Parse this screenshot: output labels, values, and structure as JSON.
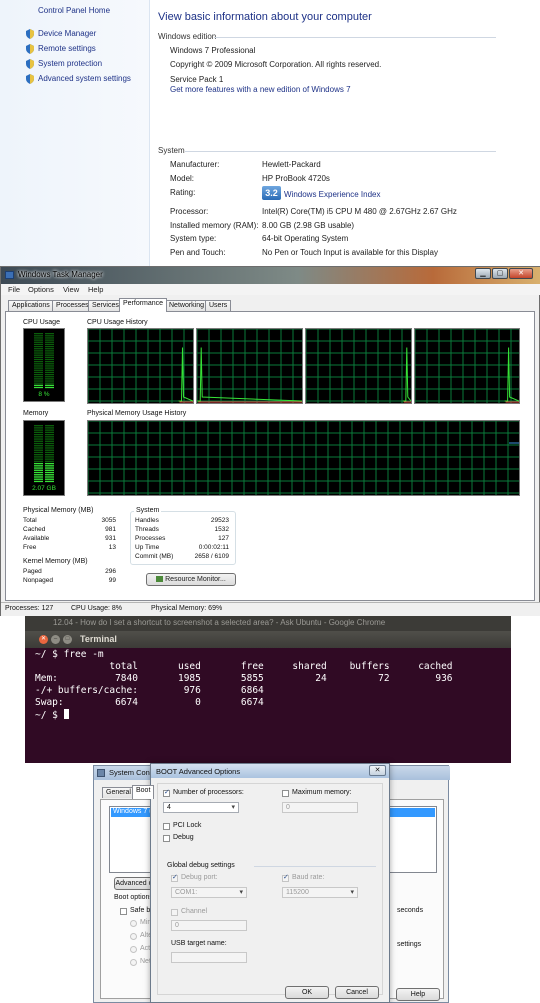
{
  "system_panel": {
    "sidebar": {
      "home": "Control Panel Home",
      "links": [
        "Device Manager",
        "Remote settings",
        "System protection",
        "Advanced system settings"
      ]
    },
    "heading": "View basic information about your computer",
    "edition_header": "Windows edition",
    "edition": "Windows 7 Professional",
    "copyright": "Copyright © 2009 Microsoft Corporation.  All rights reserved.",
    "service_pack": "Service Pack 1",
    "more_features_link": "Get more features with a new edition of Windows 7",
    "system_header": "System",
    "rows": [
      {
        "label": "Manufacturer:",
        "value": "Hewlett-Packard"
      },
      {
        "label": "Model:",
        "value": "HP ProBook 4720s"
      },
      {
        "label": "Rating:",
        "value": ""
      },
      {
        "label": "Processor:",
        "value": "Intel(R) Core(TM) i5 CPU       M 480  @ 2.67GHz   2.67 GHz"
      },
      {
        "label": "Installed memory (RAM):",
        "value": "8.00 GB (2.98 GB usable)"
      },
      {
        "label": "System type:",
        "value": "64-bit Operating System"
      },
      {
        "label": "Pen and Touch:",
        "value": "No Pen or Touch Input is available for this Display"
      }
    ],
    "rating_score": "3.2",
    "rating_link": "Windows Experience Index"
  },
  "task_manager": {
    "title": "Windows Task Manager",
    "window_buttons": {
      "minimize": "▁",
      "maximize": "▢",
      "close": "✕"
    },
    "menu": [
      "File",
      "Options",
      "View",
      "Help"
    ],
    "tabs": [
      "Applications",
      "Processes",
      "Services",
      "Performance",
      "Networking",
      "Users"
    ],
    "active_tab": "Performance",
    "cpu_usage_label": "CPU Usage",
    "cpu_usage_value": "8 %",
    "cpu_usage_fraction": 0.08,
    "cpu_history_label": "CPU Usage History",
    "memory_label": "Memory",
    "memory_value": "2.07 GB",
    "memory_fraction": 0.34,
    "memory_history_label": "Physical Memory Usage History",
    "physical_memory": {
      "title": "Physical Memory (MB)",
      "rows": [
        {
          "label": "Total",
          "value": "3055"
        },
        {
          "label": "Cached",
          "value": "981"
        },
        {
          "label": "Available",
          "value": "931"
        },
        {
          "label": "Free",
          "value": "13"
        }
      ]
    },
    "kernel_memory": {
      "title": "Kernel Memory (MB)",
      "rows": [
        {
          "label": "Paged",
          "value": "296"
        },
        {
          "label": "Nonpaged",
          "value": "99"
        }
      ]
    },
    "system": {
      "title": "System",
      "rows": [
        {
          "label": "Handles",
          "value": "29523"
        },
        {
          "label": "Threads",
          "value": "1532"
        },
        {
          "label": "Processes",
          "value": "127"
        },
        {
          "label": "Up Time",
          "value": "0:00:02:11"
        },
        {
          "label": "Commit (MB)",
          "value": "2658 / 6109"
        }
      ]
    },
    "resource_monitor_button": "Resource Monitor...",
    "status": {
      "processes": "Processes: 127",
      "cpu": "CPU Usage: 8%",
      "memory": "Physical Memory: 69%"
    }
  },
  "terminal": {
    "top_bar_text": "12.04 - How do I set a shortcut to screenshot a selected area? - Ask Ubuntu - Google Chrome",
    "title": "Terminal",
    "buttons": {
      "close": "✕",
      "minimize": "–",
      "maximize": "□"
    },
    "lines": [
      "~/ $ free -m",
      "             total       used       free     shared    buffers     cached",
      "Mem:          7840       1985       5855         24         72        936",
      "-/+ buffers/cache:        976       6864",
      "Swap:         6674          0       6674"
    ],
    "prompt": "~/ $ "
  },
  "system_config": {
    "title": "System Conf",
    "tabs": [
      "General",
      "Boot"
    ],
    "list_item": "Windows 7 (C",
    "advanced_button": "Advanced o",
    "boot_options_label": "Boot options",
    "safe_boot_label": "Safe bo",
    "radio_labels": [
      "Mini",
      "Alter",
      "Acti",
      "Netw"
    ],
    "right_fragments": [
      "seconds",
      "settings"
    ],
    "help_button": "Help"
  },
  "boot_advanced": {
    "title": "BOOT Advanced Options",
    "close": "✕",
    "num_processors_label": "Number of processors:",
    "num_processors_value": "4",
    "max_memory_label": "Maximum memory:",
    "max_memory_value": "0",
    "pci_lock": "PCI Lock",
    "debug": "Debug",
    "global_debug_label": "Global debug settings",
    "debug_port_label": "Debug port:",
    "debug_port_value": "COM1:",
    "baud_rate_label": "Baud rate:",
    "baud_rate_value": "115200",
    "channel_label": "Channel",
    "channel_value": "0",
    "usb_target_label": "USB target name:",
    "ok": "OK",
    "cancel": "Cancel"
  }
}
